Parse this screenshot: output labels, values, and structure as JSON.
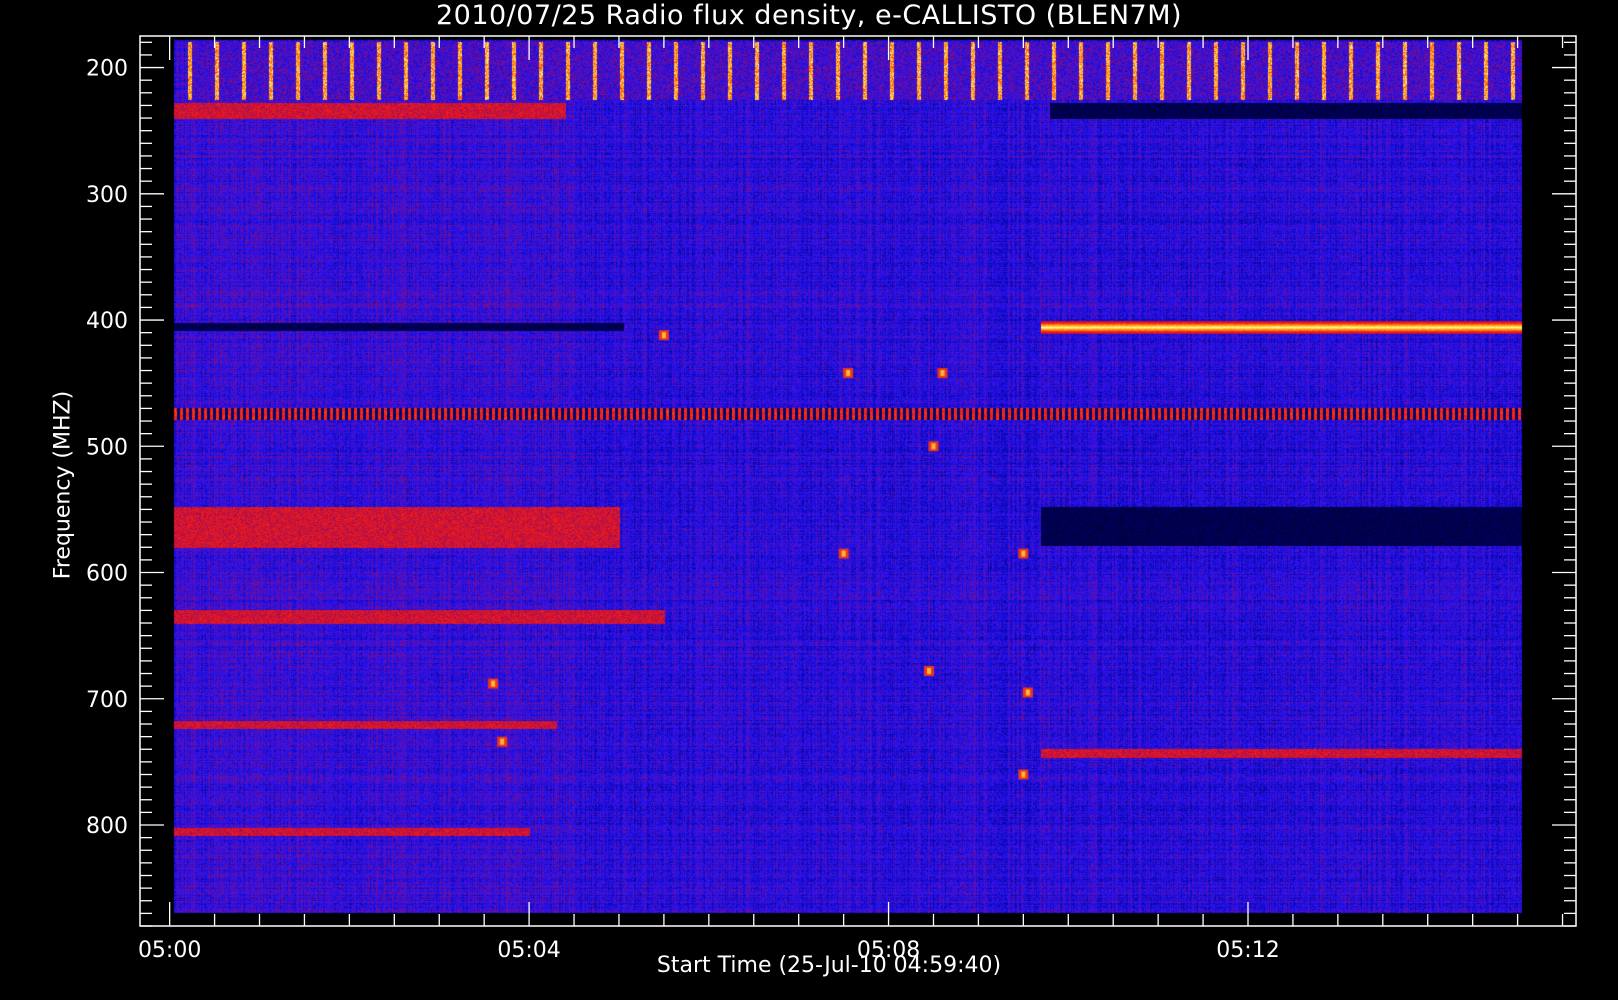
{
  "chart_data": {
    "type": "heatmap",
    "title": "2010/07/25  Radio flux density, e-CALLISTO (BLEN7M)",
    "xlabel": "Start Time (25-Jul-10 04:59:40)",
    "ylabel": "Frequency (MHZ)",
    "x_ticks": [
      "05:00",
      "05:04",
      "05:08",
      "05:12"
    ],
    "x_tick_minutes": [
      0,
      4,
      8,
      12
    ],
    "x_range_minutes": [
      -0.33,
      15.65
    ],
    "data_range_minutes": [
      0.05,
      15.05
    ],
    "y_ticks": [
      200,
      300,
      400,
      500,
      600,
      700,
      800
    ],
    "y_range_mhz": [
      175,
      880
    ],
    "data_range_mhz": [
      178,
      870
    ],
    "y_inverted": true,
    "colormap": [
      "#000000",
      "#00008b",
      "#2020ff",
      "#a01010",
      "#ff2000",
      "#ff8000",
      "#ffff80"
    ],
    "features": [
      {
        "kind": "periodic-bursts",
        "freq_mhz": [
          180,
          225
        ],
        "time_min": [
          0.2,
          15.05
        ],
        "period_min": 0.3
      },
      {
        "kind": "band",
        "freq_mhz": [
          228,
          240
        ],
        "time_min": [
          0.05,
          4.4
        ],
        "level": "red"
      },
      {
        "kind": "band",
        "freq_mhz": [
          228,
          240
        ],
        "time_min": [
          9.8,
          15.05
        ],
        "level": "dark"
      },
      {
        "kind": "band",
        "freq_mhz": [
          402,
          408
        ],
        "time_min": [
          0.05,
          5.05
        ],
        "level": "dark"
      },
      {
        "kind": "band",
        "freq_mhz": [
          401,
          410
        ],
        "time_min": [
          9.7,
          15.05
        ],
        "level": "bright"
      },
      {
        "kind": "band",
        "freq_mhz": [
          470,
          478
        ],
        "time_min": [
          0.05,
          15.05
        ],
        "level": "mixed"
      },
      {
        "kind": "band",
        "freq_mhz": [
          548,
          580
        ],
        "time_min": [
          0.05,
          5.0
        ],
        "level": "red"
      },
      {
        "kind": "band",
        "freq_mhz": [
          548,
          578
        ],
        "time_min": [
          9.7,
          15.05
        ],
        "level": "dark"
      },
      {
        "kind": "band",
        "freq_mhz": [
          630,
          640
        ],
        "time_min": [
          0.05,
          5.5
        ],
        "level": "red"
      },
      {
        "kind": "band",
        "freq_mhz": [
          718,
          723
        ],
        "time_min": [
          0.05,
          4.3
        ],
        "level": "red"
      },
      {
        "kind": "band",
        "freq_mhz": [
          802,
          808
        ],
        "time_min": [
          0.05,
          4.0
        ],
        "level": "red"
      },
      {
        "kind": "band",
        "freq_mhz": [
          740,
          746
        ],
        "time_min": [
          9.7,
          15.05
        ],
        "level": "red"
      }
    ],
    "grid": false
  }
}
